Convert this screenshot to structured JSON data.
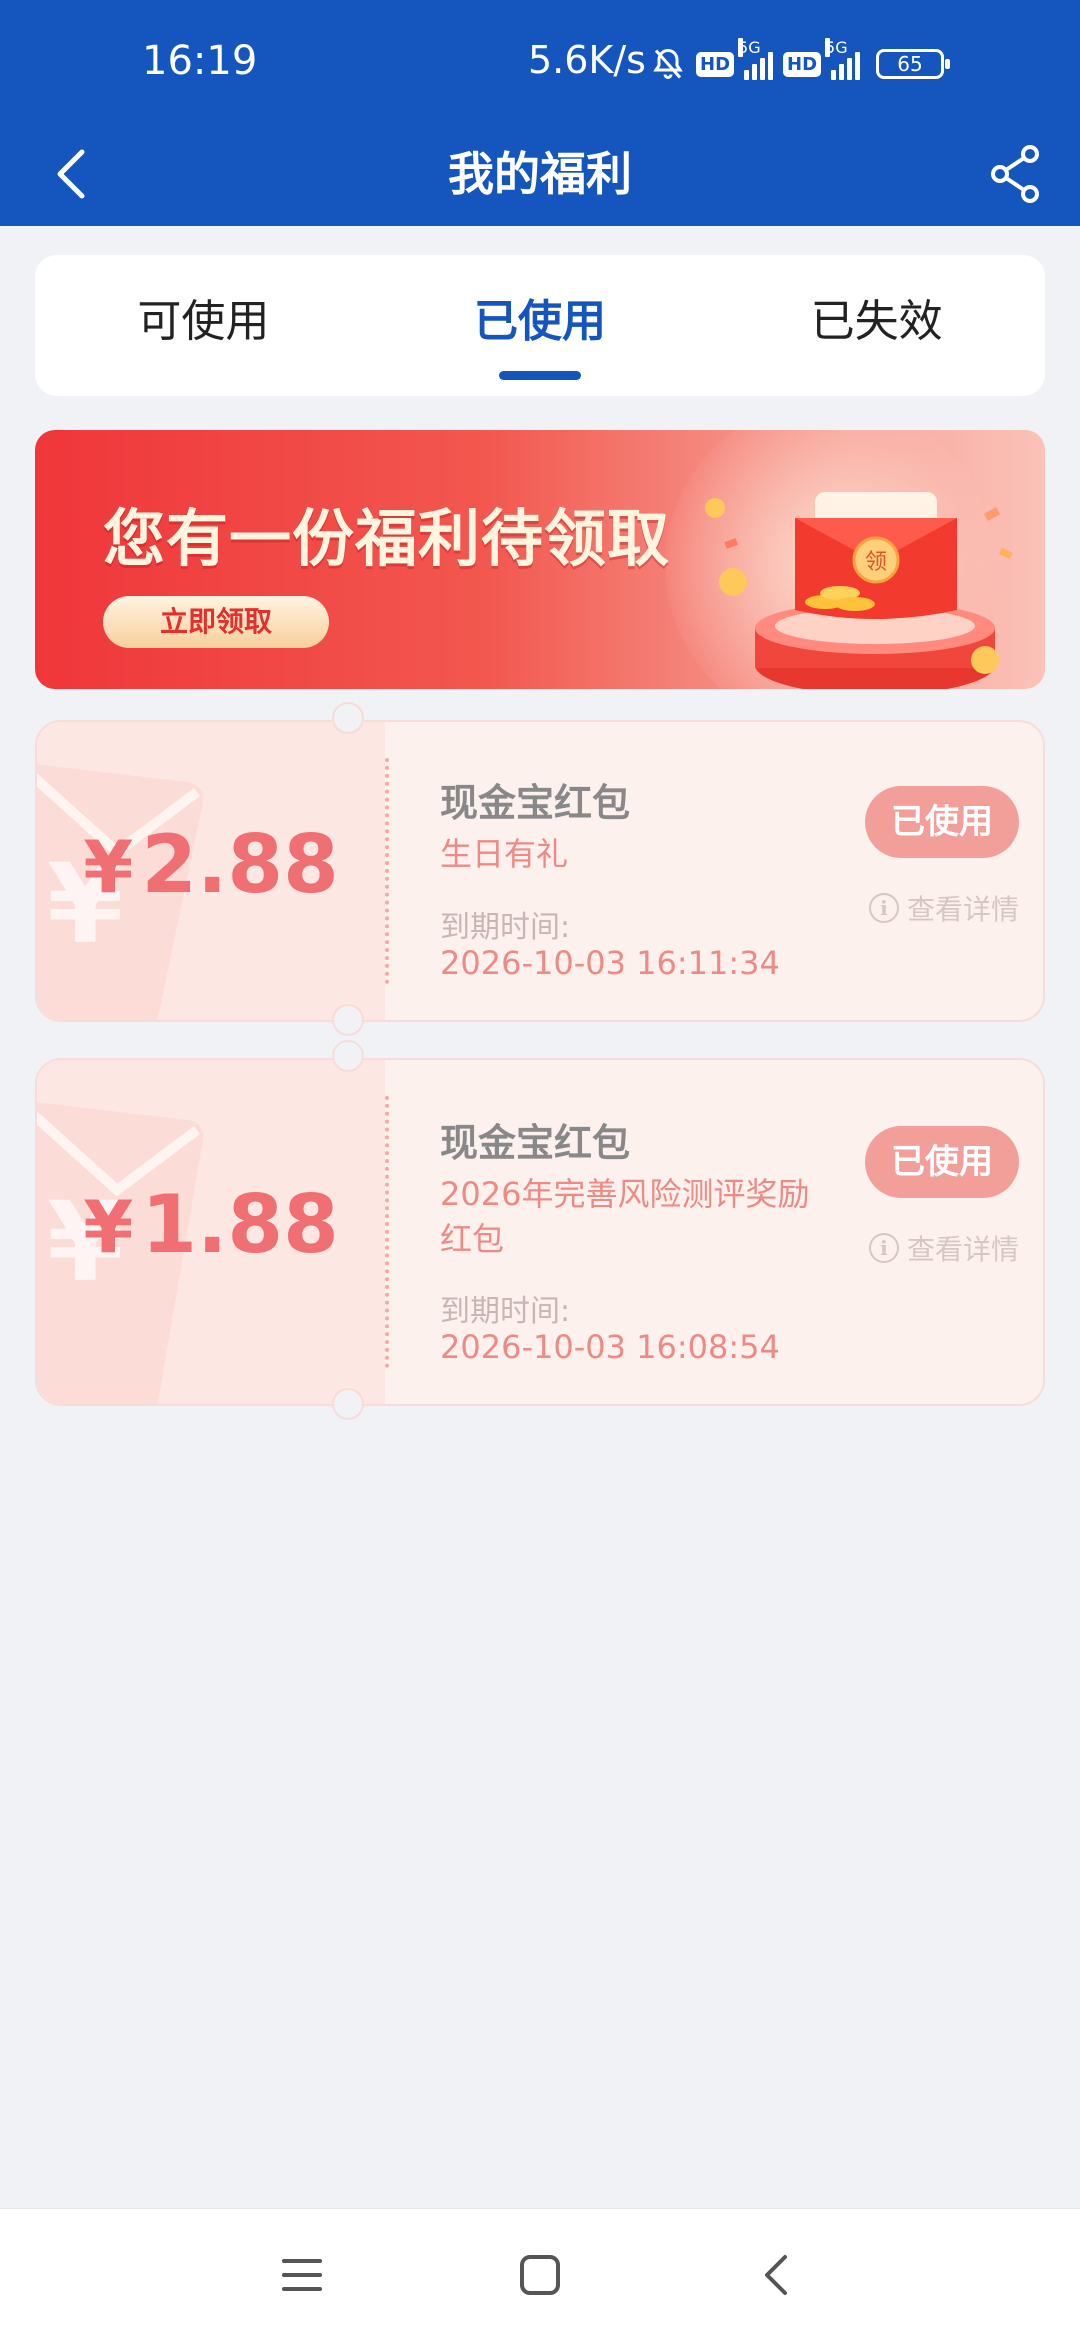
{
  "status_bar": {
    "time": "16:19",
    "net_speed": "5.6K/s",
    "hd1": "HD",
    "sig1_tag": "5G",
    "hd2": "HD",
    "sig2_tag": "5G",
    "battery": "65"
  },
  "header": {
    "title": "我的福利",
    "back_icon": "chevron-left-icon",
    "share_icon": "share-icon",
    "background": "#1456bd"
  },
  "tabs": [
    {
      "label": "可使用",
      "active": false
    },
    {
      "label": "已使用",
      "active": true
    },
    {
      "label": "已失效",
      "active": false
    }
  ],
  "banner": {
    "title": "您有一份福利待领取",
    "button_label": "立即领取",
    "envelope_char": "领"
  },
  "coupons": [
    {
      "currency": "¥",
      "amount": "2.88",
      "title": "现金宝红包",
      "subtitle": "生日有礼",
      "expiry_label": "到期时间:",
      "expiry": "2026-10-03 16:11:34",
      "status_label": "已使用",
      "detail_label": "查看详情"
    },
    {
      "currency": "¥",
      "amount": "1.88",
      "title": "现金宝红包",
      "subtitle": "2026年完善风险测评奖励红包",
      "expiry_label": "到期时间:",
      "expiry": "2026-10-03 16:08:54",
      "status_label": "已使用",
      "detail_label": "查看详情"
    }
  ],
  "colors": {
    "accent": "#1456bd",
    "coupon_text": "#ef6f73",
    "used_button": "#f19f98"
  },
  "nav_bar": {
    "menu_icon": "menu-icon",
    "home_icon": "home-icon",
    "back_icon": "back-icon"
  }
}
